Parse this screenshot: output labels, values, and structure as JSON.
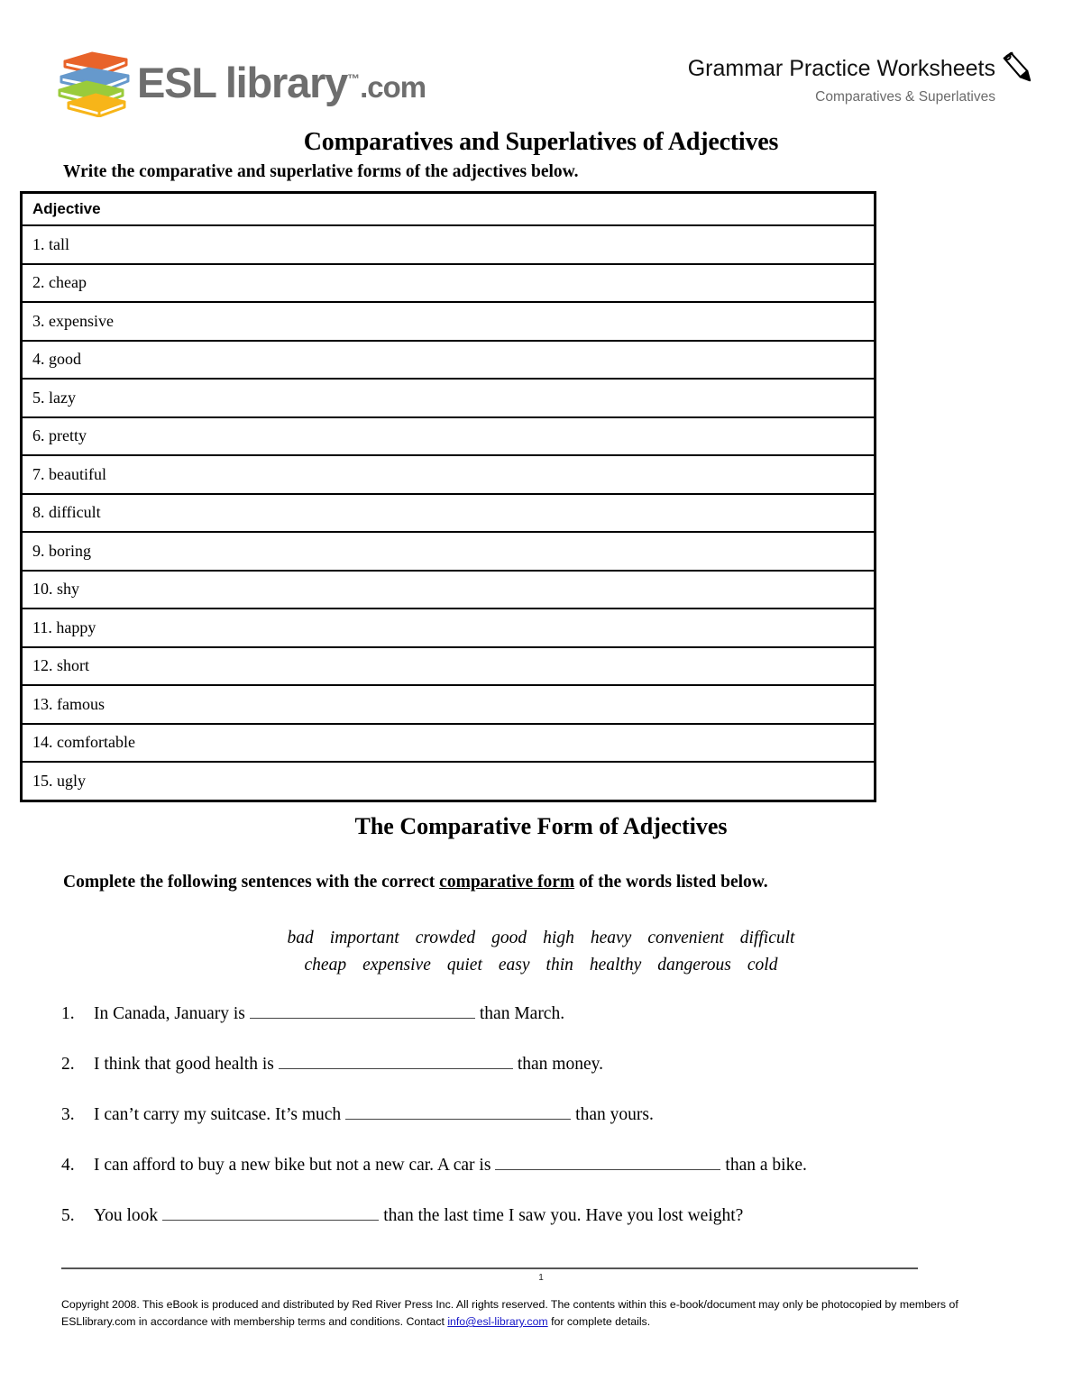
{
  "brand": {
    "logo_icon": "stacked-books-icon",
    "wordmark_primary": "ESL",
    "wordmark_secondary": "library",
    "wordmark_tm": "™",
    "wordmark_tld": ".com",
    "book_colors": [
      "#e8632a",
      "#6699cc",
      "#9acb3b",
      "#f7b519"
    ],
    "wordmark_color": "#6e6e6e"
  },
  "header": {
    "title": "Grammar Practice Worksheets",
    "subtitle": "Comparatives & Superlatives",
    "pencil_icon": "pencil-icon",
    "subtitle_color": "#6b6b6b"
  },
  "document": {
    "title": "Comparatives and Superlatives of Adjectives",
    "instruction": "Write the comparative and superlative forms of the adjectives below."
  },
  "adjective_table": {
    "column_header": "Adjective",
    "rows": [
      "1. tall",
      "2. cheap",
      "3. expensive",
      "4. good",
      "5. lazy",
      "6. pretty",
      "7. beautiful",
      "8. difficult",
      "9. boring",
      "10. shy",
      "11. happy",
      "12. short",
      "13. famous",
      "14. comfortable",
      "15. ugly"
    ]
  },
  "section2": {
    "title": "The Comparative Form of Adjectives",
    "instruction_pre": "Complete the following sentences with the correct ",
    "instruction_underlined": "comparative form",
    "instruction_post": " of the words listed below.",
    "wordbank_row1": [
      "bad",
      "important",
      "crowded",
      "good",
      "high",
      "heavy",
      "convenient",
      "difficult"
    ],
    "wordbank_row2": [
      "cheap",
      "expensive",
      "quiet",
      "easy",
      "thin",
      "healthy",
      "dangerous",
      "cold"
    ],
    "sentences": [
      {
        "number": "1.",
        "before": "In Canada, January is",
        "blank_width": 250,
        "after": "than March."
      },
      {
        "number": "2.",
        "before": "I think that good health is",
        "blank_width": 260,
        "after": "than money."
      },
      {
        "number": "3.",
        "before": "I can’t carry my suitcase. It’s much",
        "blank_width": 250,
        "after": "than yours."
      },
      {
        "number": "4.",
        "before": "I can afford to buy a new bike but not a new car. A car is",
        "blank_width": 250,
        "after": "than a bike."
      },
      {
        "number": "5.",
        "before": "You look",
        "blank_width": 240,
        "after": "than the last time I saw you.  Have you lost weight?"
      }
    ]
  },
  "footer": {
    "page_number": "1",
    "copyright_part1": "Copyright 2008.  This eBook is produced and distributed by Red River Press Inc.  All rights reserved.  The contents within this e-book/document may only be photocopied by members of ESLlibrary.com in accordance with membership terms and conditions. Contact ",
    "email": "info@esl-library.com",
    "copyright_part2": " for complete details.",
    "email_color": "#1414c8"
  }
}
